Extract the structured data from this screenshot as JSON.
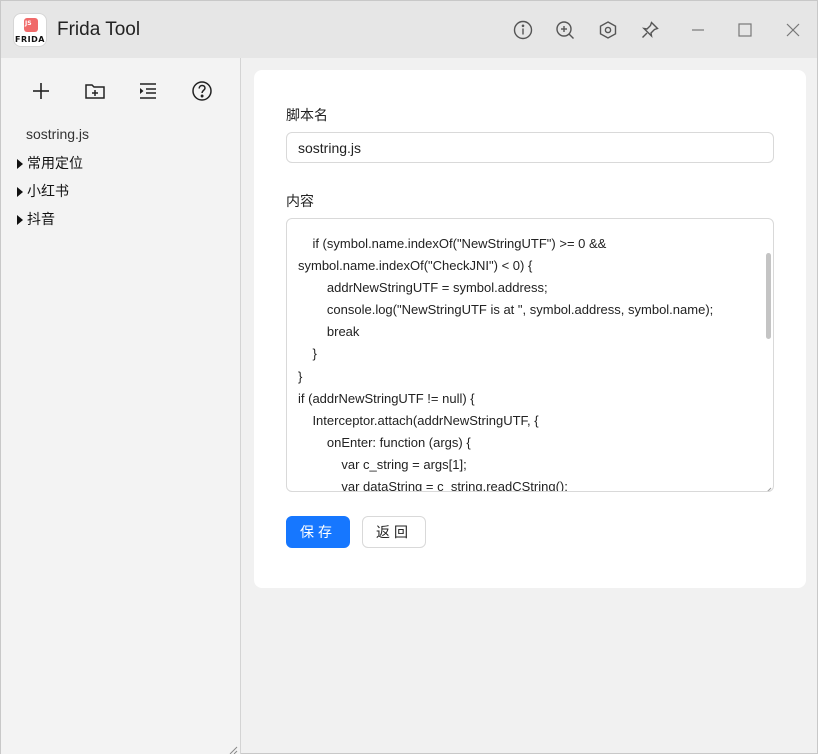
{
  "app": {
    "title": "Frida Tool",
    "logo_text": "FRIDA",
    "logo_badge": "JS"
  },
  "titlebar_icons": [
    "info-icon",
    "zoom-in-icon",
    "settings-hexagon-icon",
    "pin-icon",
    "minimize-icon",
    "maximize-icon",
    "close-icon"
  ],
  "sidebar": {
    "tools": [
      "add-icon",
      "new-folder-icon",
      "indent-list-icon",
      "help-icon"
    ],
    "file": "sostring.js",
    "folders": [
      "常用定位",
      "小红书",
      "抖音"
    ]
  },
  "form": {
    "name_label": "脚本名",
    "name_value": "sostring.js",
    "content_label": "内容",
    "content": "    if (symbol.name.indexOf(\"NewStringUTF\") >= 0 &&\nsymbol.name.indexOf(\"CheckJNI\") < 0) {\n        addrNewStringUTF = symbol.address;\n        console.log(\"NewStringUTF is at \", symbol.address, symbol.name);\n        break\n    }\n}\nif (addrNewStringUTF != null) {\n    Interceptor.attach(addrNewStringUTF, {\n        onEnter: function (args) {\n            var c_string = args[1];\n            var dataString = c_string.readCString();",
    "save_label": "保存",
    "back_label": "返回"
  },
  "colors": {
    "primary": "#1677ff",
    "logo_accent": "#f06a6a"
  }
}
